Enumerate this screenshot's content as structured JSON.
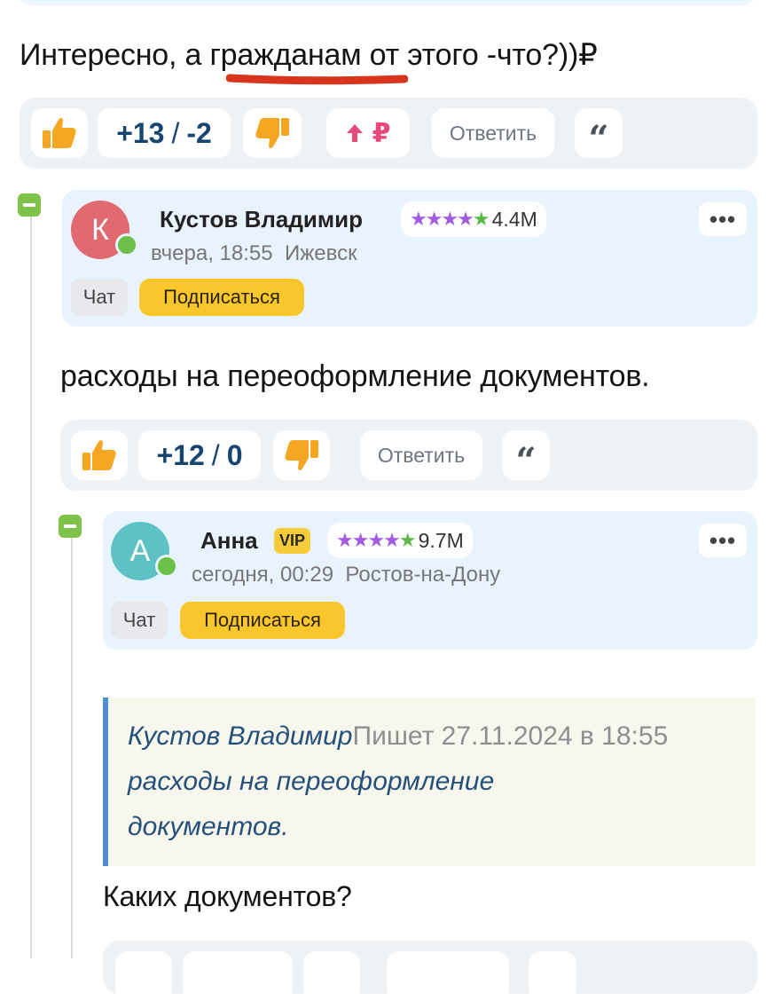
{
  "comment1": {
    "text": "Интересно, а гражданам от этого -что?))₽",
    "score_plus": "+13",
    "score_sep": "/",
    "score_minus": "-2",
    "reply_label": "Ответить",
    "ruble_symbol": "₽"
  },
  "comment2": {
    "avatar_letter": "К",
    "author": "Кустов Владимир",
    "stars": "★★★★",
    "star_last": "★",
    "rating": "4.4M",
    "time": "вчера, 18:55",
    "city": "Ижевск",
    "chat_label": "Чат",
    "subscribe_label": "Подписаться",
    "more_label": "•••",
    "text": "расходы на переоформление документов.",
    "score_plus": "+12",
    "score_sep": "/",
    "score_minus": "0",
    "reply_label": "Ответить"
  },
  "comment3": {
    "avatar_letter": "А",
    "author": "Анна",
    "vip": "VIP",
    "stars": "★★★★",
    "star_last": "★",
    "rating": "9.7M",
    "time": "сегодня, 00:29",
    "city": "Ростов-на-Дону",
    "chat_label": "Чат",
    "subscribe_label": "Подписаться",
    "more_label": "•••",
    "quote_author": "Кустов Владимир",
    "quote_meta": "Пишет 27.11.2024 в 18:55",
    "quote_line1": "расходы на переоформление",
    "quote_line2": "документов.",
    "text": "Каких документов?"
  },
  "icons": {
    "like": "thumbs-up-icon",
    "dislike": "thumbs-down-icon",
    "quote": "quote-icon",
    "boost": "arrow-up-icon",
    "collapse": "minus-icon"
  },
  "colors": {
    "card_bg": "#e9f3fd",
    "action_bar_bg": "#eff2f5",
    "score": "#17456f",
    "like_orange": "#f5a623",
    "subscribe_yellow": "#f9c72c",
    "collapse_green": "#7fc24a",
    "boost_pink": "#e84a78",
    "highlight_red": "#d9341c"
  },
  "quote_mark": "“"
}
